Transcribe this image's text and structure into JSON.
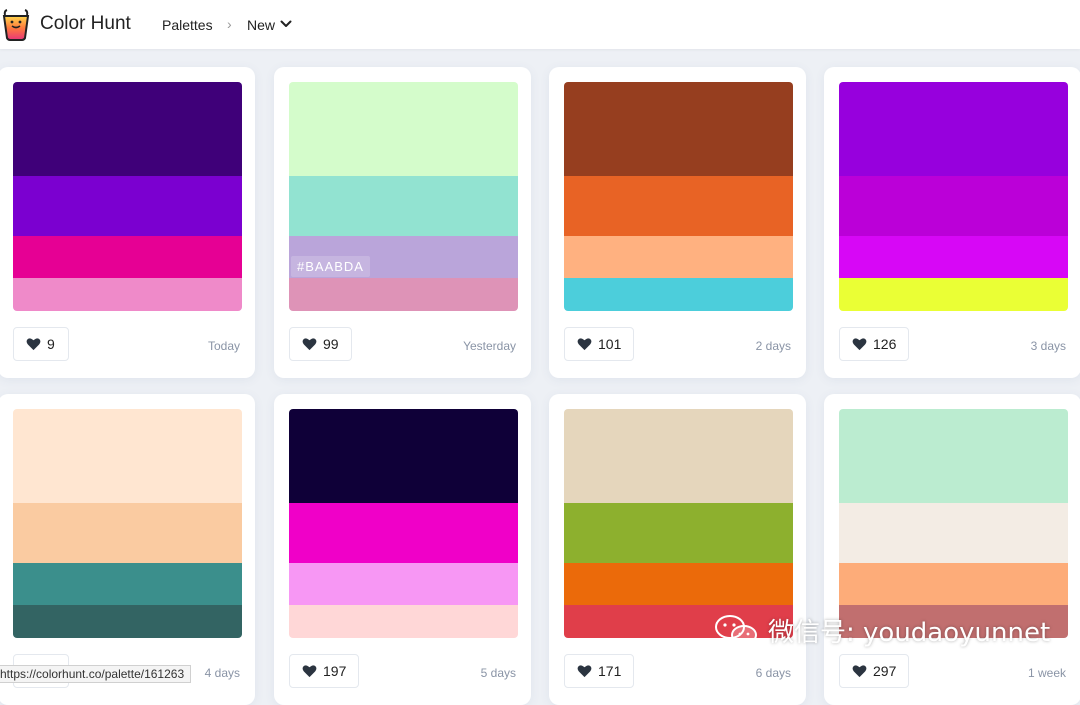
{
  "header": {
    "brand": "Color Hunt",
    "nav_palettes": "Palettes",
    "nav_separator": "›",
    "nav_new": "New"
  },
  "palettes": [
    {
      "colors": [
        "#3f0079",
        "#7b00d0",
        "#e60094",
        "#ef8ac9"
      ],
      "likes": "9",
      "date": "Today"
    },
    {
      "colors": [
        "#d4fccb",
        "#92e3d1",
        "#baa5da",
        "#de93b7"
      ],
      "likes": "99",
      "date": "Yesterday",
      "hover_hex": "#BAABDA"
    },
    {
      "colors": [
        "#963e1f",
        "#e86325",
        "#ffb180",
        "#4ccedb"
      ],
      "likes": "101",
      "date": "2 days"
    },
    {
      "colors": [
        "#9700dd",
        "#bb00d8",
        "#d707f6",
        "#eaff35"
      ],
      "likes": "126",
      "date": "3 days"
    },
    {
      "colors": [
        "#ffe6d1",
        "#facba1",
        "#3b8f8c",
        "#336463"
      ],
      "likes": "",
      "date": "4 days"
    },
    {
      "colors": [
        "#0f0038",
        "#f000c8",
        "#f797f4",
        "#ffd7d7"
      ],
      "likes": "197",
      "date": "5 days"
    },
    {
      "colors": [
        "#e5d6bc",
        "#8db02e",
        "#eb6a0a",
        "#e03e4a"
      ],
      "likes": "171",
      "date": "6 days"
    },
    {
      "colors": [
        "#bbecd0",
        "#f3ece4",
        "#fdac79",
        "#c16f6f"
      ],
      "likes": "297",
      "date": "1 week"
    }
  ],
  "status_url": "https://colorhunt.co/palette/161263",
  "watermark_text": "微信号: youdaoyunnet",
  "icons": {
    "logo": "paint-cup-logo-icon",
    "like": "heart-icon",
    "dropdown": "chevron-down-icon",
    "watermark": "wechat-icon"
  }
}
